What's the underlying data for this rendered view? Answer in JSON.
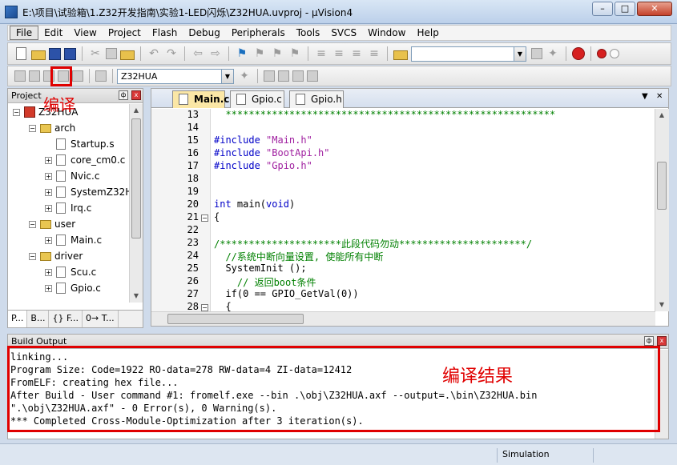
{
  "window": {
    "title": "E:\\项目\\试验箱\\1.Z32开发指南\\实验1-LED闪烁\\Z32HUA.uvproj - µVision4",
    "min": "–",
    "max": "□",
    "close": "✕"
  },
  "menu": [
    "File",
    "Edit",
    "View",
    "Project",
    "Flash",
    "Debug",
    "Peripherals",
    "Tools",
    "SVCS",
    "Window",
    "Help"
  ],
  "toolbar": {
    "find_value": "",
    "target_select": "Z32HUA"
  },
  "project_panel": {
    "title": "Project",
    "pin": "ф",
    "close": "x",
    "tree": [
      {
        "level": 0,
        "exp": "−",
        "icon": "target",
        "label": "Z32HUA"
      },
      {
        "level": 1,
        "exp": "−",
        "icon": "folder",
        "label": "arch"
      },
      {
        "level": 2,
        "exp": "",
        "icon": "file",
        "label": "Startup.s"
      },
      {
        "level": 2,
        "exp": "+",
        "icon": "file",
        "label": "core_cm0.c"
      },
      {
        "level": 2,
        "exp": "+",
        "icon": "file",
        "label": "Nvic.c"
      },
      {
        "level": 2,
        "exp": "+",
        "icon": "file",
        "label": "SystemZ32H"
      },
      {
        "level": 2,
        "exp": "+",
        "icon": "file",
        "label": "Irq.c"
      },
      {
        "level": 1,
        "exp": "−",
        "icon": "folder",
        "label": "user"
      },
      {
        "level": 2,
        "exp": "+",
        "icon": "file",
        "label": "Main.c"
      },
      {
        "level": 1,
        "exp": "−",
        "icon": "folder",
        "label": "driver"
      },
      {
        "level": 2,
        "exp": "+",
        "icon": "file",
        "label": "Scu.c"
      },
      {
        "level": 2,
        "exp": "+",
        "icon": "file",
        "label": "Gpio.c"
      }
    ],
    "tabs": [
      "P...",
      "B...",
      "{} F...",
      "0→ T..."
    ]
  },
  "annotations": {
    "compile": "编译",
    "result": "编译结果"
  },
  "editor": {
    "tabs": [
      "Main.c",
      "Gpio.c",
      "Gpio.h"
    ],
    "menu_arrow": "▼",
    "close": "✕",
    "lines": [
      {
        "n": "13",
        "fold": "",
        "text": "  *********************************************************",
        "cls": "c-green"
      },
      {
        "n": "14",
        "fold": "",
        "text": "",
        "cls": "c-black"
      },
      {
        "n": "15",
        "fold": "",
        "text": "#include \"Main.h\"",
        "cls": "inc"
      },
      {
        "n": "16",
        "fold": "",
        "text": "#include \"BootApi.h\"",
        "cls": "inc"
      },
      {
        "n": "17",
        "fold": "",
        "text": "#include \"Gpio.h\"",
        "cls": "inc"
      },
      {
        "n": "18",
        "fold": "",
        "text": "",
        "cls": "c-black"
      },
      {
        "n": "19",
        "fold": "",
        "text": "",
        "cls": "c-black"
      },
      {
        "n": "20",
        "fold": "",
        "text": "int main(void)",
        "cls": "c-blue"
      },
      {
        "n": "21",
        "fold": "−",
        "text": "{",
        "cls": "c-black"
      },
      {
        "n": "22",
        "fold": "",
        "text": "",
        "cls": "c-black"
      },
      {
        "n": "23",
        "fold": "",
        "text": "/*********************此段代码勿动**********************/",
        "cls": "c-green"
      },
      {
        "n": "24",
        "fold": "",
        "text": "  //系统中断向量设置, 使能所有中断",
        "cls": "c-green"
      },
      {
        "n": "25",
        "fold": "",
        "text": "  SystemInit ();",
        "cls": "c-black"
      },
      {
        "n": "26",
        "fold": "",
        "text": "    // 返回boot条件",
        "cls": "c-green"
      },
      {
        "n": "27",
        "fold": "",
        "text": "  if(0 == GPIO_GetVal(0))",
        "cls": "c-black"
      },
      {
        "n": "28",
        "fold": "−",
        "text": "  {",
        "cls": "c-black"
      }
    ]
  },
  "build_output": {
    "title": "Build Output",
    "lines": [
      "linking...",
      "Program Size: Code=1922 RO-data=278 RW-data=4 ZI-data=12412",
      "FromELF: creating hex file...",
      "After Build - User command #1: fromelf.exe --bin .\\obj\\Z32HUA.axf --output=.\\bin\\Z32HUA.bin",
      "\".\\obj\\Z32HUA.axf\" - 0 Error(s), 0 Warning(s).",
      "*** Completed Cross-Module-Optimization after 3 iteration(s)."
    ]
  },
  "status": {
    "mode": "Simulation"
  }
}
